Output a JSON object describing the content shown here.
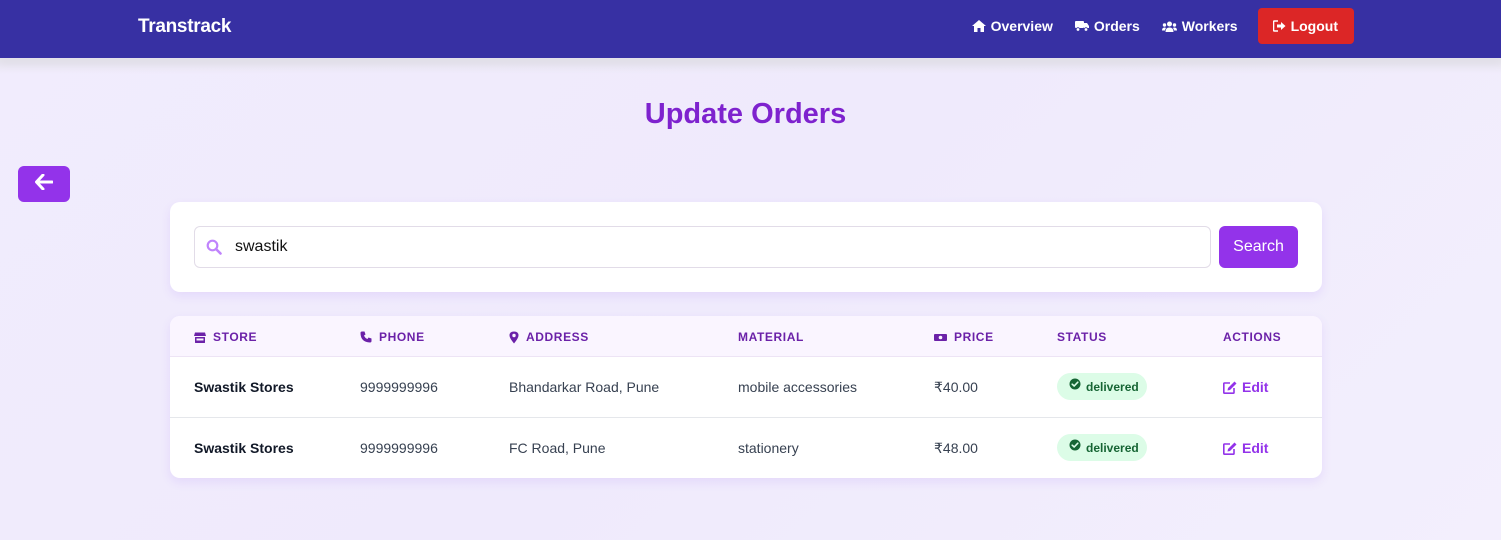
{
  "nav": {
    "brand": "Transtrack",
    "links": [
      {
        "label": "Overview",
        "icon": "home-icon"
      },
      {
        "label": "Orders",
        "icon": "truck-icon"
      },
      {
        "label": "Workers",
        "icon": "users-icon"
      }
    ],
    "logout": {
      "label": "Logout",
      "icon": "sign-out-icon"
    }
  },
  "page": {
    "title": "Update Orders",
    "back_icon": "arrow-left-icon"
  },
  "search": {
    "value": "swastik",
    "button_label": "Search",
    "icon": "search-icon"
  },
  "table": {
    "columns": [
      {
        "label": "STORE",
        "icon": "store-icon"
      },
      {
        "label": "PHONE",
        "icon": "phone-icon"
      },
      {
        "label": "ADDRESS",
        "icon": "map-marker-icon"
      },
      {
        "label": "MATERIAL",
        "icon": ""
      },
      {
        "label": "PRICE",
        "icon": "money-icon"
      },
      {
        "label": "STATUS",
        "icon": ""
      },
      {
        "label": "ACTIONS",
        "icon": ""
      }
    ],
    "rows": [
      {
        "store": "Swastik Stores",
        "phone": "9999999996",
        "address": "Bhandarkar Road, Pune",
        "material": "mobile accessories",
        "price": "₹40.00",
        "status": "delivered",
        "action": "Edit"
      },
      {
        "store": "Swastik Stores",
        "phone": "9999999996",
        "address": "FC Road, Pune",
        "material": "stationery",
        "price": "₹48.00",
        "status": "delivered",
        "action": "Edit"
      }
    ]
  },
  "colors": {
    "navbar": "#3730a3",
    "accent": "#9333ea",
    "title": "#7e22ce",
    "logout": "#dc2626",
    "status_bg": "#dcfce7",
    "status_text": "#166534"
  }
}
